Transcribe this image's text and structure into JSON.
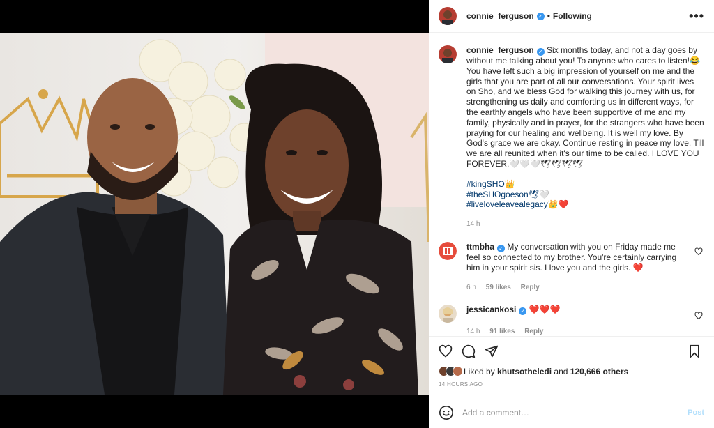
{
  "post": {
    "author": "connie_ferguson",
    "follow_status": "Following",
    "more_glyph": "•••",
    "verified_glyph": "✓"
  },
  "caption": {
    "author": "connie_ferguson",
    "text": "Six months today, and not a day goes by without me talking about you! To anyone who cares to listen!😂 You have left such a big impression of yourself on me and the girls that you are part of all our conversations. Your spirit lives on Sho, and we bless God for walking this journey with us, for strengthening us daily and comforting us in different ways, for the earthly angels who have been supportive of me and my family, physically and in prayer, for the strangers who have been praying for our healing and wellbeing. It is well my love. By God's grace we are okay. Continue resting in peace my love. Till we are all reunited when it's our time to be called. I LOVE YOU FOREVER.🤍🤍🤍🕊🕊🕊🕊",
    "hashtags": [
      "#kingSHO👑",
      "#theSHOgoeson🕊🤍",
      "#liveloveleavealegacy👑❤️"
    ],
    "time": "14 h"
  },
  "comments": [
    {
      "user": "ttmbha",
      "text": "My conversation with you on Friday made me feel so connected to my brother. You're certainly carrying him in your spirit sis. I love you and the girls. ❤️",
      "time": "6 h",
      "likes": "59 likes",
      "reply": "Reply"
    },
    {
      "user": "jessicankosi",
      "text": "❤️❤️❤️",
      "time": "14 h",
      "likes": "91 likes",
      "reply": "Reply"
    }
  ],
  "likes": {
    "prefix": "Liked by",
    "user": "khutsotheledi",
    "middle": "and",
    "others": "120,666 others"
  },
  "timestamp": "14 HOURS AGO",
  "add_comment": {
    "placeholder": "Add a comment…",
    "post_label": "Post"
  },
  "icons": {
    "like": "heart-icon",
    "comment": "comment-icon",
    "share": "paper-plane-icon",
    "save": "bookmark-icon",
    "emoji": "smiley-icon"
  },
  "colors": {
    "link": "#00376b",
    "verified": "#3897f0",
    "muted": "#8e8e8e",
    "post_disabled": "#b2dffc",
    "heart": "#ed4956"
  }
}
